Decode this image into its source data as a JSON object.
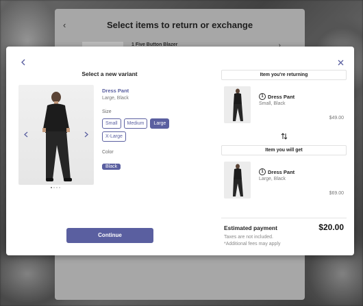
{
  "background_page": {
    "back_icon": "chevron-left-icon",
    "title": "Select items to return or exchange",
    "item_label": "Five Button Blazer",
    "item_quantity": "1",
    "chevron_icon": "chevron-right-icon"
  },
  "modal": {
    "back_icon": "chevron-left-icon",
    "close_icon": "close-icon",
    "heading": "Select a new variant",
    "product": {
      "name": "Dress Pant",
      "variant": "Large, Black",
      "image_prev_icon": "chevron-left-icon",
      "image_next_icon": "chevron-right-icon",
      "dot_count": 4,
      "active_dot": 0
    },
    "size": {
      "label": "Size",
      "options": [
        "Small",
        "Medium",
        "Large",
        "X-Large"
      ],
      "selected": "Large"
    },
    "color": {
      "label": "Color",
      "options": [
        "Black"
      ],
      "selected": "Black"
    },
    "continue_label": "Continue",
    "returning": {
      "header": "Item you're returning",
      "quantity": "1",
      "name": "Dress Pant",
      "variant": "Small, Black",
      "price": "$49.00"
    },
    "swap_icon": "swap-vertical-icon",
    "getting": {
      "header": "Item you will get",
      "quantity": "1",
      "name": "Dress Pant",
      "variant": "Large, Black",
      "price": "$69.00"
    },
    "estimated_payment": {
      "label": "Estimated payment",
      "amount": "$20.00",
      "tax_note": "Taxes are not included.",
      "fee_note": "*Additional fees may apply"
    }
  },
  "colors": {
    "accent": "#5a5fa0",
    "modal_background": "#ffffff",
    "overlay": "#3b3b3b"
  }
}
